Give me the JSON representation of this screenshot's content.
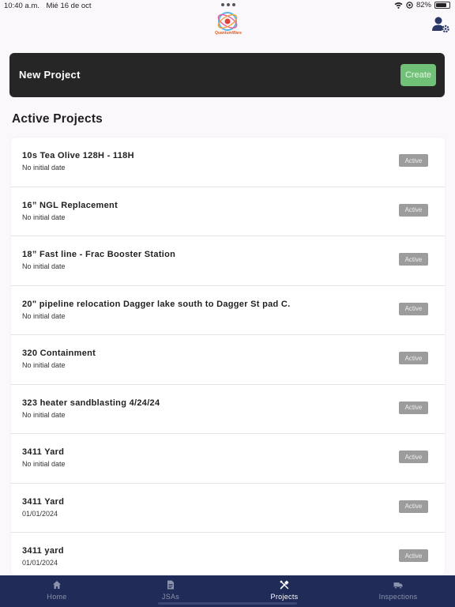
{
  "status_bar": {
    "time": "10:40 a.m.",
    "date": "Mié 16 de oct",
    "battery": "82%",
    "battery_level": 0.82
  },
  "header": {
    "logo_text": "QuantumWare"
  },
  "new_project": {
    "label": "New Project",
    "create_label": "Create"
  },
  "section_title": "Active Projects",
  "projects": [
    {
      "name": "10s Tea Olive 128H - 118H",
      "date": "No initial date",
      "status": "Active"
    },
    {
      "name": "16” NGL Replacement",
      "date": "No initial date",
      "status": "Active"
    },
    {
      "name": "18” Fast line - Frac Booster Station",
      "date": "No initial date",
      "status": "Active"
    },
    {
      "name": "20\" pipeline relocation Dagger lake south to Dagger St pad C.",
      "date": "No initial date",
      "status": "Active"
    },
    {
      "name": "320 Containment",
      "date": "No initial date",
      "status": "Active"
    },
    {
      "name": "323 heater sandblasting 4/24/24",
      "date": "No initial date",
      "status": "Active"
    },
    {
      "name": "3411 Yard",
      "date": "No initial date",
      "status": "Active"
    },
    {
      "name": "3411 Yard",
      "date": "01/01/2024",
      "status": "Active"
    },
    {
      "name": "3411 yard",
      "date": "01/01/2024",
      "status": "Active"
    }
  ],
  "nav": {
    "home": "Home",
    "jsas": "JSAs",
    "projects": "Projects",
    "inspections": "Inspections"
  },
  "colors": {
    "nav_bg": "#202b57",
    "create_button": "#71c078",
    "card_dark": "#262626",
    "badge": "#9c9c9c"
  }
}
